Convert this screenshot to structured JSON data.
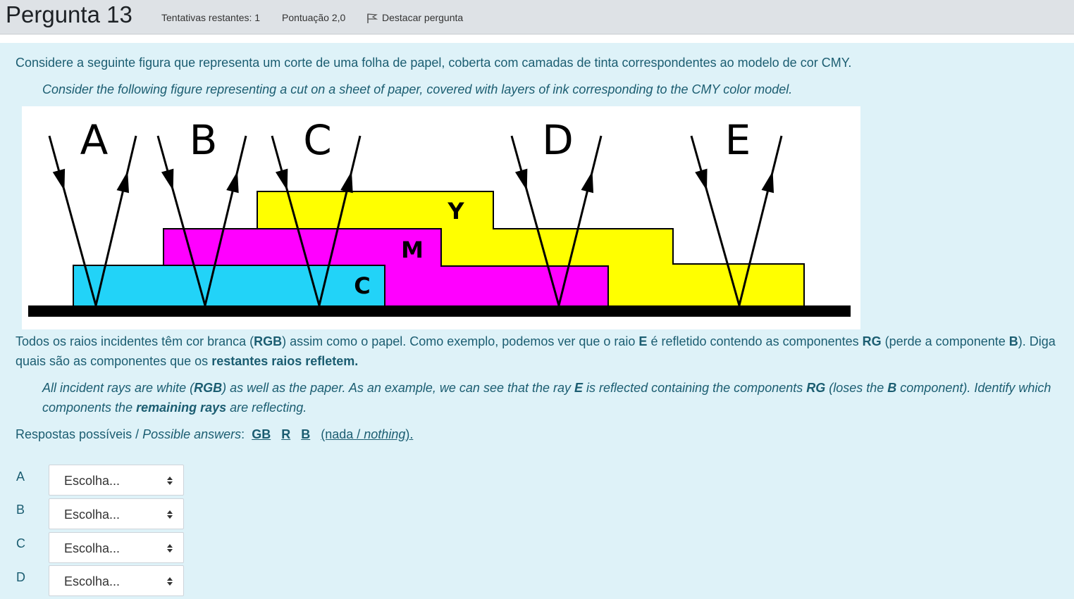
{
  "question": {
    "title": "Pergunta 13",
    "attempts": "Tentativas restantes: 1",
    "score": "Pontuação 2,0",
    "flag_label": "Destacar pergunta"
  },
  "text": {
    "intro_pt": "Considere a seguinte figura que representa um corte de uma folha de papel, coberta com camadas de tinta correspondentes ao modelo de cor CMY.",
    "intro_en": "Consider the following figure representing a cut on a sheet of paper, covered with layers of ink corresponding to the CMY color model.",
    "body_pt": {
      "p1": "Todos os raios incidentes têm cor branca (",
      "rgb": "RGB",
      "p2": ") assim como o papel. Como exemplo, podemos ver que o raio ",
      "e": "E",
      "p3": " é refletido contendo as componentes ",
      "rg": "RG",
      "p4": " (perde a componente ",
      "b": "B",
      "p5": "). Diga quais são as componentes que os ",
      "bold_end": "restantes raios refletem."
    },
    "body_en": {
      "p1": "All incident rays are white (",
      "rgb": "RGB",
      "p2": ") as well as the paper. As an example, we can see that the ray ",
      "e": "E",
      "p3": " is reflected containing the components ",
      "rg": "RG",
      "p4": " (loses the ",
      "b": "B",
      "p5": " component). Identify which components the ",
      "bold": "remaining rays",
      "p6": " are reflecting."
    },
    "answers_pt": "Respostas possíveis / ",
    "answers_en": "Possible answers",
    "answers_colon": ":",
    "options": [
      "GB",
      "R",
      "B"
    ],
    "nada_open": "(nada / ",
    "nada_en": "nothing",
    "nada_close": ")."
  },
  "figure": {
    "ray_labels": [
      "A",
      "B",
      "C",
      "D",
      "E"
    ],
    "layer_labels": {
      "yellow": "Y",
      "magenta": "M",
      "cyan": "C"
    },
    "colors": {
      "cyan": "#22d3f8",
      "magenta": "#ff00ff",
      "yellow": "#ffff00",
      "paper": "#000000"
    }
  },
  "selects": [
    {
      "label": "A",
      "value": "Escolha..."
    },
    {
      "label": "B",
      "value": "Escolha..."
    },
    {
      "label": "C",
      "value": "Escolha..."
    },
    {
      "label": "D",
      "value": "Escolha..."
    }
  ]
}
